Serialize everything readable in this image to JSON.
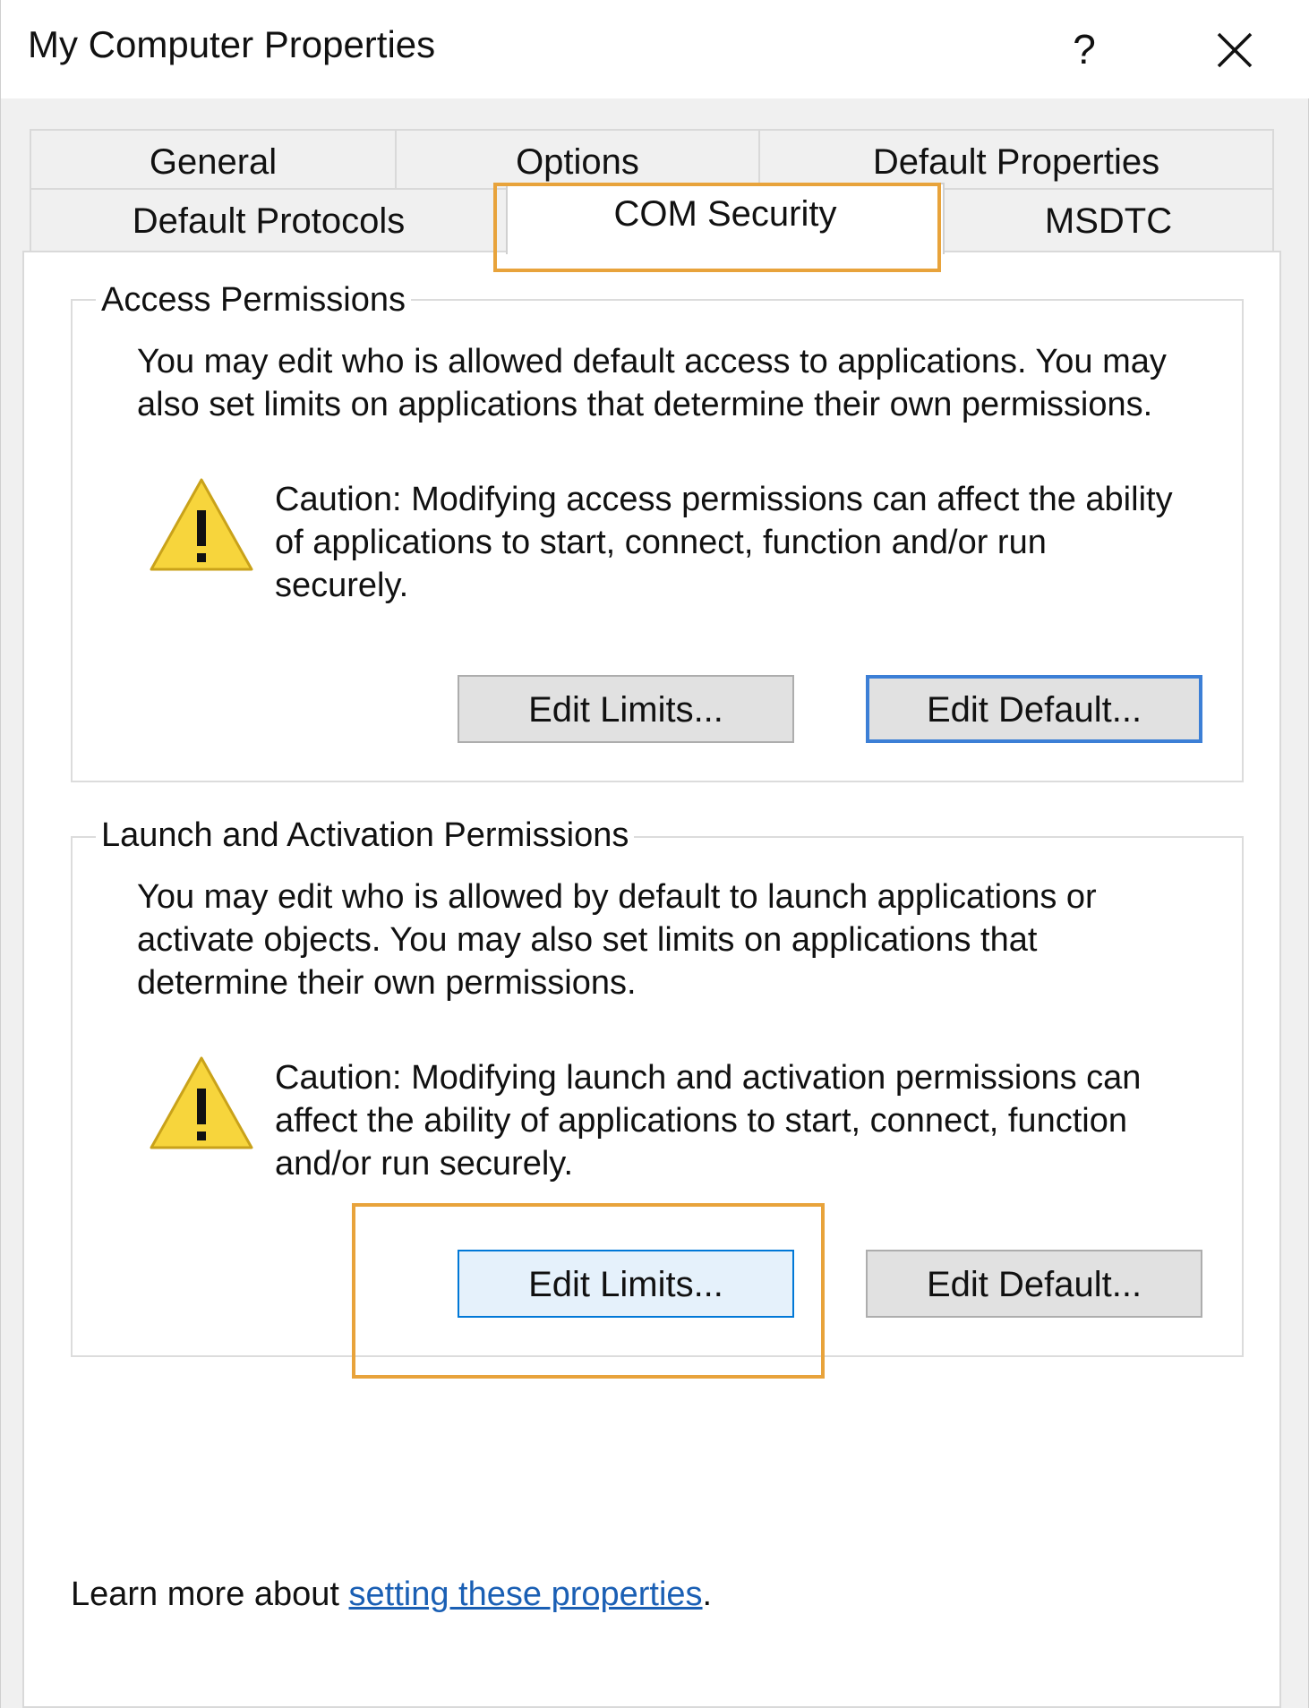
{
  "window": {
    "title": "My Computer Properties",
    "help_label": "?",
    "close_icon": "close-icon"
  },
  "tabs": {
    "row1": [
      {
        "label": "General"
      },
      {
        "label": "Options"
      },
      {
        "label": "Default Properties"
      }
    ],
    "row2": [
      {
        "label": "Default Protocols"
      },
      {
        "label": "COM Security",
        "active": true
      },
      {
        "label": "MSDTC"
      }
    ]
  },
  "access_permissions": {
    "legend": "Access Permissions",
    "description_line1": "You may edit who is allowed default access to applications. You may",
    "description_line2": "also set limits on applications that determine their own permissions.",
    "caution_line1": "Caution: Modifying access permissions can affect the ability",
    "caution_line2": "of applications to start, connect, function and/or run",
    "caution_line3": "securely.",
    "edit_limits_label": "Edit Limits...",
    "edit_default_label": "Edit Default..."
  },
  "launch_permissions": {
    "legend": "Launch and Activation Permissions",
    "description_line1": "You may edit who is allowed by default to launch applications or",
    "description_line2": "activate objects. You may also set limits on applications that",
    "description_line3": "determine their own permissions.",
    "caution_line1": "Caution: Modifying launch and activation permissions can",
    "caution_line2": "affect the ability of applications to start, connect, function",
    "caution_line3": "and/or run securely.",
    "edit_limits_label": "Edit Limits...",
    "edit_default_label": "Edit Default..."
  },
  "footer": {
    "prefix": "Learn more about ",
    "link_text": "setting these properties",
    "suffix": "."
  },
  "colors": {
    "highlight": "#e8a33b",
    "link": "#1a5fb4",
    "focus_border": "#3c7fd6",
    "warning_fill": "#f7d53c"
  }
}
